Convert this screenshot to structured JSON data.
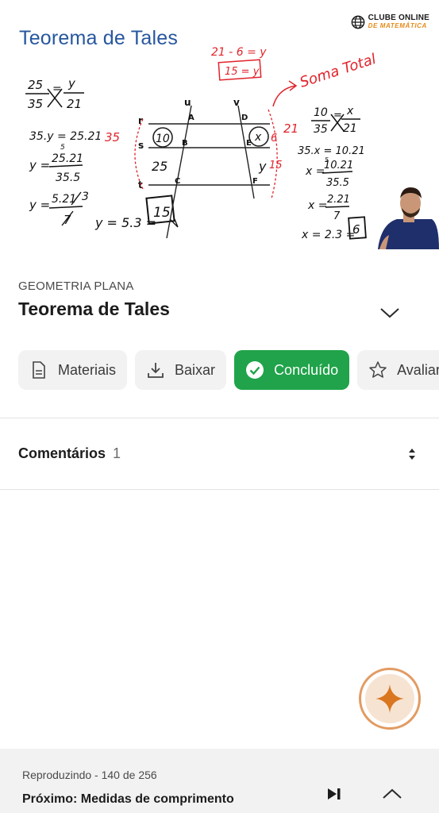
{
  "video": {
    "board_title": "Teorema de Tales",
    "brand_line1": "CLUBE ONLINE",
    "brand_line2": "DE MATEMÁTICA",
    "notes": {
      "left_eq1_num": "25",
      "left_eq1_den": "35",
      "left_eq1_rnum": "y",
      "left_eq1_rden": "21",
      "left_step1": "35.y = 25.21",
      "left_step1_cancel": "5",
      "left_step2_lhs": "y =",
      "left_step2_num": "25.21",
      "left_step2_den": "35.5",
      "left_step3_lhs": "y =",
      "left_step3_num": "5.21",
      "left_step3_den": "7",
      "left_step3_mark": "3",
      "left_result": "y = 5.3 =",
      "left_result_box": "15",
      "top_eq": "21 - 6 = y",
      "top_result": "15 = y",
      "soma_total": "Soma Total",
      "right_eq1_num": "10",
      "right_eq1_den": "35",
      "right_eq1_rnum": "x",
      "right_eq1_rden": "21",
      "right_step1": "35.x = 10.21",
      "right_step1_cancel": "5",
      "right_step2_lhs": "x =",
      "right_step2_num": "10.21",
      "right_step2_den": "35.5",
      "right_step3_lhs": "x =",
      "right_step3_num": "2.21",
      "right_step3_den": "7",
      "right_result": "x = 2.3 =",
      "right_result_box": "6",
      "diagram_labels": {
        "u": "u",
        "v": "v",
        "r": "r",
        "s": "s",
        "t": "t",
        "A": "A",
        "B": "B",
        "C": "C",
        "D": "D",
        "E": "E",
        "F": "F",
        "seg_10": "10",
        "seg_25": "25",
        "seg_x": "x",
        "seg_y": "y",
        "red_35": "35",
        "red_21": "21",
        "red_6": "6",
        "red_15": "15"
      }
    }
  },
  "lesson": {
    "category": "GEOMETRIA PLANA",
    "title": "Teorema de Tales"
  },
  "actions": {
    "materials_label": "Materiais",
    "download_label": "Baixar",
    "completed_label": "Concluído",
    "rate_label": "Avaliar"
  },
  "comments": {
    "label": "Comentários",
    "count": "1"
  },
  "player": {
    "status": "Reproduzindo - 140 de 256",
    "next_label": "Próximo: Medidas de comprimento"
  },
  "colors": {
    "title_blue": "#27579e",
    "completed_green": "#20a34a",
    "ink_red": "#e0242c",
    "fab_orange": "#d9761f"
  }
}
